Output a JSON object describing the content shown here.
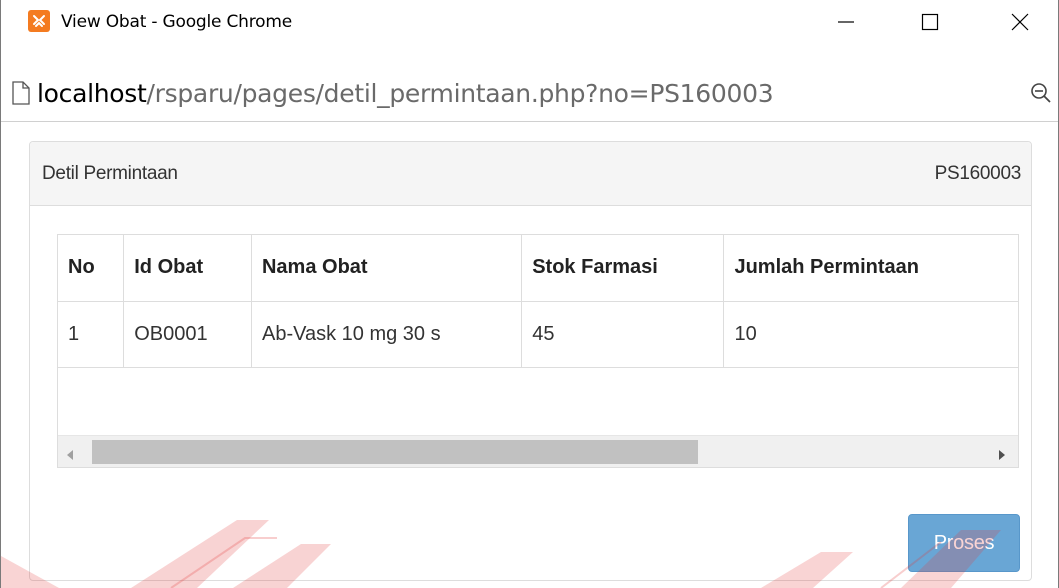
{
  "window": {
    "title": "View Obat - Google Chrome"
  },
  "address_bar": {
    "host": "localhost",
    "path": "/rsparu/pages/detil_permintaan.php?no=PS160003"
  },
  "panel": {
    "title": "Detil Permintaan",
    "code": "PS160003"
  },
  "table": {
    "columns": [
      "No",
      "Id Obat",
      "Nama Obat",
      "Stok Farmasi",
      "Jumlah Permintaan"
    ],
    "rows": [
      [
        "1",
        "OB0001",
        "Ab-Vask 10 mg 30 s",
        "45",
        "10"
      ]
    ]
  },
  "actions": {
    "proses_label": "Proses"
  },
  "colors": {
    "app_icon": "#f47b20",
    "button": "#5d9fd2",
    "panel_heading_bg": "#f5f5f5",
    "watermark": "#e33a3a"
  },
  "icons": [
    "xampp-app-icon",
    "minimize-icon",
    "maximize-icon",
    "close-icon",
    "page-icon",
    "zoom-icon",
    "scroll-left-arrow-icon",
    "scroll-right-arrow-icon"
  ]
}
